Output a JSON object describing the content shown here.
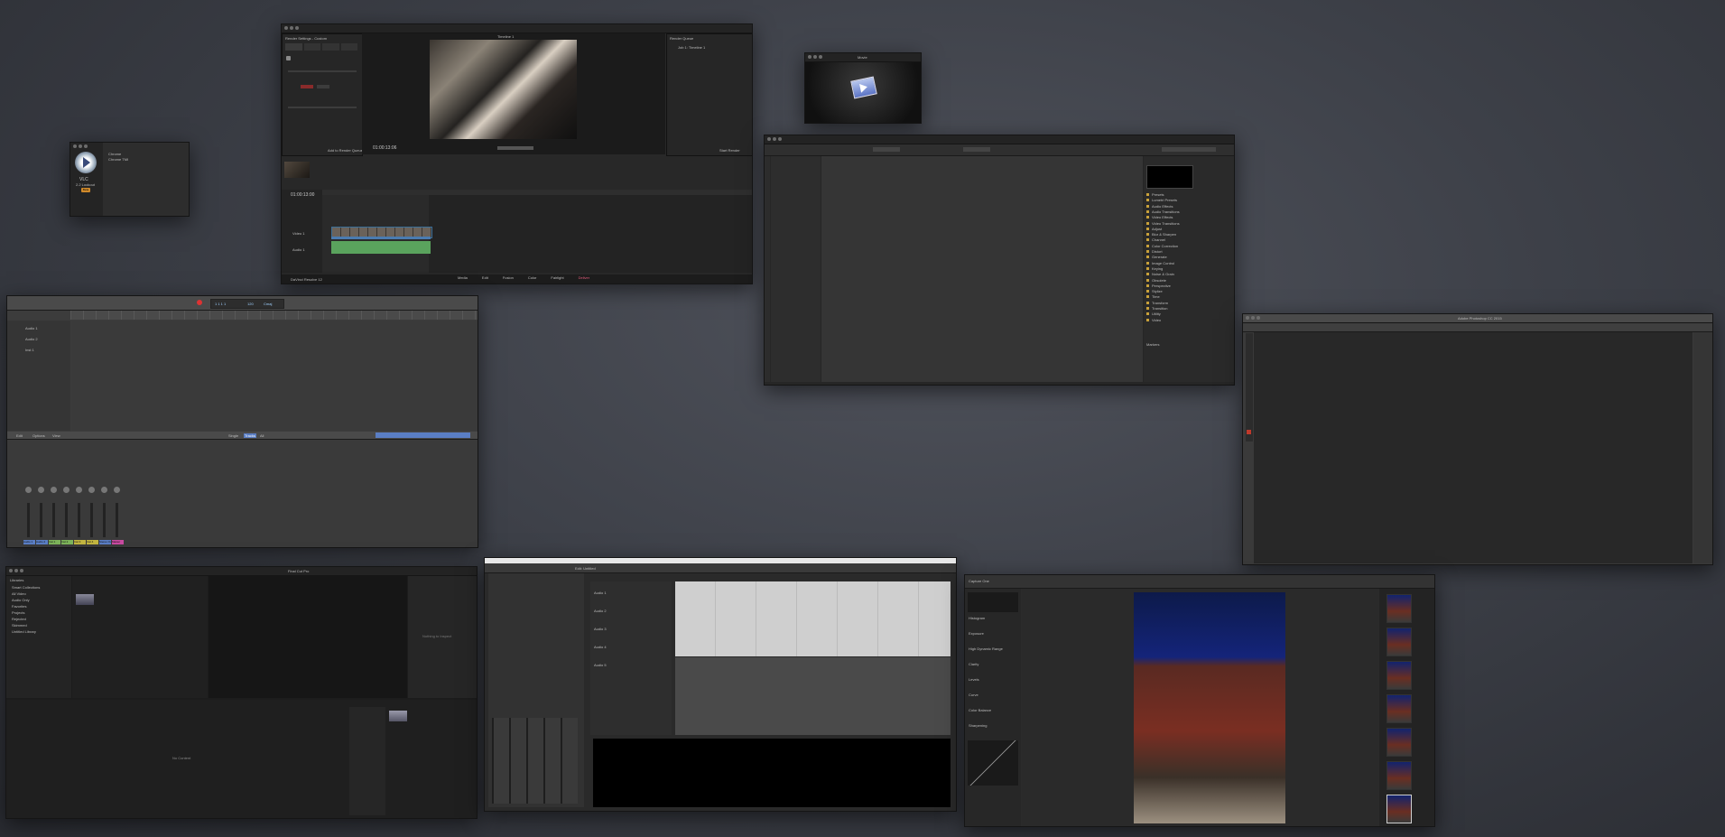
{
  "desktop": {
    "background_color": "#3f4249"
  },
  "video_app": {
    "icon": "play-button-icon",
    "items": [
      "Chrome",
      "Chrome TMI"
    ],
    "app_label": "VLC",
    "app_sub": "2.2 Lookout",
    "badge": "Beta"
  },
  "resolve": {
    "panel_left_title": "Render Settings - Custom",
    "viewer_title": "Timeline 1",
    "render_queue_title": "Render Queue",
    "timecode": "01:00:13:06",
    "timeline_timecode": "01:00:13:00",
    "logo": "DaVinci Resolve 12",
    "pages": [
      "Media",
      "Edit",
      "Fusion",
      "Color",
      "Fairlight",
      "Deliver"
    ],
    "job_item": "Job 1: Timeline 1",
    "add_queue": "Add to Render Queue",
    "start_render": "Start Render",
    "tracks": [
      "Video 1",
      "Audio 1"
    ]
  },
  "small_player": {
    "title": "Movie"
  },
  "premiere": {
    "effects_title": "Effects",
    "effects_list": [
      "Presets",
      "Lumetri Presets",
      "Audio Effects",
      "Audio Transitions",
      "Video Effects",
      "Video Transitions",
      "Adjust",
      "Blur & Sharpen",
      "Channel",
      "Color Correction",
      "Distort",
      "Generate",
      "Image Control",
      "Keying",
      "Noise & Grain",
      "Obsolete",
      "Perspective",
      "Stylize",
      "Time",
      "Transform",
      "Transition",
      "Utility",
      "Video"
    ],
    "info_label": "Markers"
  },
  "photoshop": {
    "title": "Adobe Photoshop CC 2015"
  },
  "logic": {
    "lcd": "1 1 1 1",
    "tempo": "120",
    "key": "Cmaj",
    "track_labels": [
      "Audio 1",
      "Audio 2",
      "Inst 1"
    ],
    "mixer_tabs": [
      "Edit",
      "Options",
      "View"
    ],
    "mixer_filters": [
      "Single",
      "Tracks",
      "All"
    ],
    "channel_names": [
      "Audio 1",
      "Audio 2",
      "Inst 1",
      "Inst 2",
      "Inst 3",
      "Inst 4",
      "Stereo Out",
      "Master"
    ]
  },
  "fcp": {
    "title": "Final Cut Pro",
    "library_title": "Libraries",
    "viewer_msg": "Nothing to Inspect",
    "no_content": "No Content",
    "browser_items": [
      "Smart Collections",
      "All Video",
      "Audio Only",
      "Favorites",
      "Projects",
      "Rejected",
      "Skimmed",
      "Untitled Library"
    ]
  },
  "protools": {
    "title": "Edit: Untitled",
    "tracks": [
      "Audio 1",
      "Audio 2",
      "Audio 3",
      "Audio 4",
      "Audio 5"
    ]
  },
  "capture_one": {
    "toolbar": "Capture One",
    "tools": [
      "Histogram",
      "Exposure",
      "High Dynamic Range",
      "Clarity",
      "Levels",
      "Curve",
      "Color Balance",
      "Sharpening"
    ]
  }
}
